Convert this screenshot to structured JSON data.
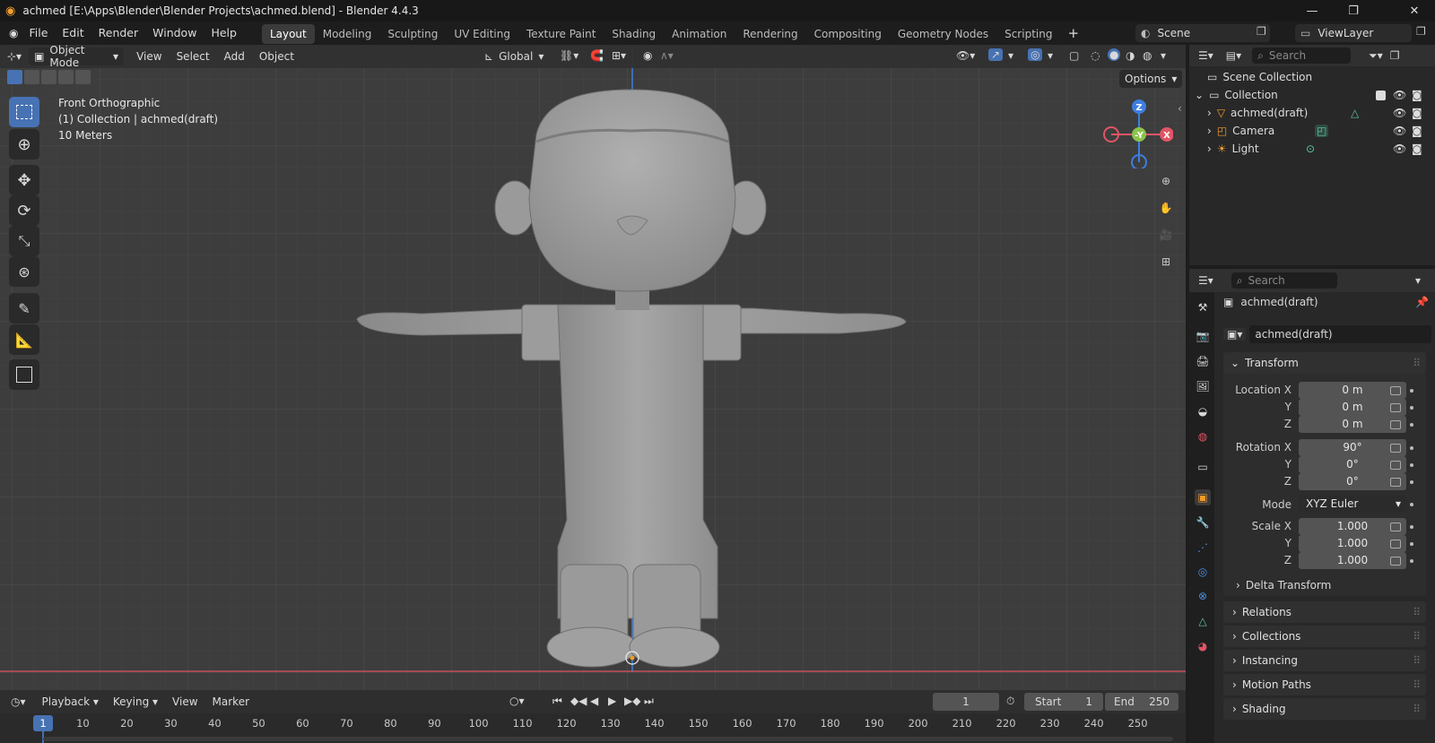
{
  "window": {
    "title": "achmed [E:\\Apps\\Blender\\Blender Projects\\achmed.blend] - Blender 4.4.3"
  },
  "menus": [
    "File",
    "Edit",
    "Render",
    "Window",
    "Help"
  ],
  "workspaces": [
    "Layout",
    "Modeling",
    "Sculpting",
    "UV Editing",
    "Texture Paint",
    "Shading",
    "Animation",
    "Rendering",
    "Compositing",
    "Geometry Nodes",
    "Scripting"
  ],
  "active_workspace": "Layout",
  "scene": "Scene",
  "view_layer": "ViewLayer",
  "viewport": {
    "mode": "Object Mode",
    "view": "View",
    "select": "Select",
    "add": "Add",
    "object": "Object",
    "orientation": "Global",
    "options": "Options",
    "overlay_line1": "Front Orthographic",
    "overlay_line2": "(1) Collection | achmed(draft)",
    "overlay_line3": "10 Meters",
    "gizmo": {
      "z": "Z",
      "y": "-Y",
      "x": "X"
    }
  },
  "outliner": {
    "search_placeholder": "Search",
    "scene_collection": "Scene Collection",
    "collection": "Collection",
    "items": [
      "achmed(draft)",
      "Camera",
      "Light"
    ]
  },
  "properties": {
    "search_placeholder": "Search",
    "object_name": "achmed(draft)",
    "data_name": "achmed(draft)",
    "transform": "Transform",
    "labels": {
      "location_x": "Location X",
      "rotation_x": "Rotation X",
      "mode": "Mode",
      "scale_x": "Scale X",
      "y": "Y",
      "z": "Z"
    },
    "location": [
      "0 m",
      "0 m",
      "0 m"
    ],
    "rotation": [
      "90°",
      "0°",
      "0°"
    ],
    "rotation_mode": "XYZ Euler",
    "scale": [
      "1.000",
      "1.000",
      "1.000"
    ],
    "subpanels": [
      "Delta Transform"
    ],
    "panels": [
      "Relations",
      "Collections",
      "Instancing",
      "Motion Paths",
      "Shading"
    ]
  },
  "timeline": {
    "playback": "Playback",
    "keying": "Keying",
    "view": "View",
    "marker": "Marker",
    "current_frame": "1",
    "start_label": "Start",
    "start": "1",
    "end_label": "End",
    "end": "250",
    "ticks": [
      "10",
      "20",
      "30",
      "40",
      "50",
      "60",
      "70",
      "80",
      "90",
      "100",
      "110",
      "120",
      "130",
      "140",
      "150",
      "160",
      "170",
      "180",
      "190",
      "200",
      "210",
      "220",
      "230",
      "240",
      "250"
    ],
    "frame_marker": "1"
  },
  "colors": {
    "accent": "#4772b3",
    "x_axis": "#e05565",
    "y_axis": "#8bc34a",
    "z_axis": "#3d7ee0",
    "viewport_bg": "#3d3d3d"
  }
}
